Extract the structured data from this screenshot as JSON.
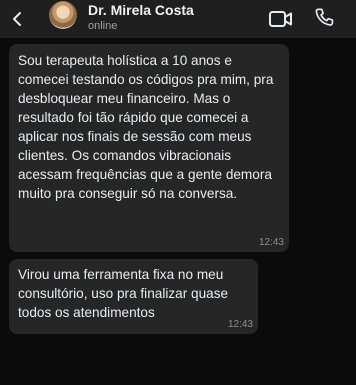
{
  "header": {
    "contact_name": "Dr. Mirela Costa",
    "status": "online",
    "icons": {
      "back": "chevron-left-icon",
      "avatar": "avatar",
      "video": "video-camera-icon",
      "call": "phone-icon"
    }
  },
  "messages": [
    {
      "text": "Sou terapeuta holística a 10 anos e comecei testando os códigos pra mim, pra desbloquear meu financeiro. Mas o resultado foi tão rápido que comecei a aplicar nos finais de sessão com meus clientes. Os comandos vibracionais acessam frequências que a gente demora muito pra conseguir só na conversa.",
      "time": "12:43"
    },
    {
      "text": "Virou uma ferramenta fixa no meu consultório, uso pra finalizar quase todos os atendimentos",
      "time": "12:43"
    }
  ],
  "colors": {
    "background": "#0b0b0b",
    "header": "#1f1f1f",
    "bubble": "#262626",
    "text": "#e9edef",
    "meta": "#8a8d8f"
  }
}
